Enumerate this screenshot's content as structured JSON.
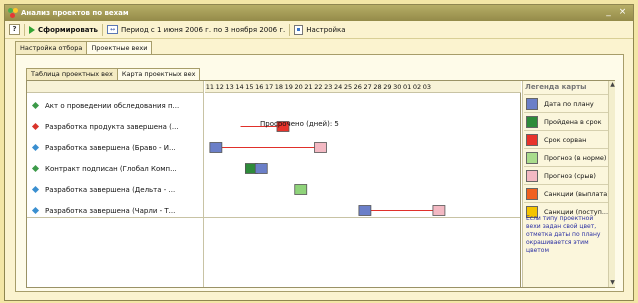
{
  "window": {
    "title": "Анализ проектов по вехам",
    "min_label": "_",
    "close_label": "×"
  },
  "toolbar": {
    "help_label": "?",
    "build_label": "Сформировать",
    "period_icon_label": "↔",
    "period_label": "Период с 1 июня 2006 г. по 3 ноября 2006 г.",
    "settings_label": "Настройка"
  },
  "tabs_top": [
    "Настройка отбора",
    "Проектные вехи"
  ],
  "tabs_inner": [
    "Таблица проектных вех",
    "Карта проектных вех"
  ],
  "rows": [
    {
      "label": "Акт о проведении обследования п...",
      "marker_color": "#3c9a49"
    },
    {
      "label": "Разработка продукта завершена (...",
      "marker_color": "#d9342b"
    },
    {
      "label": "Разработка завершена (Браво - И...",
      "marker_color": "#3a8fd0"
    },
    {
      "label": "Контракт подписан (Глобал Комп...",
      "marker_color": "#3c9a49"
    },
    {
      "label": "Разработка завершена (Дельта - ...",
      "marker_color": "#3a8fd0"
    },
    {
      "label": "Разработка завершена (Чарли - Т...",
      "marker_color": "#3a8fd0"
    }
  ],
  "days": [
    "11",
    "12",
    "13",
    "14",
    "15",
    "16",
    "17",
    "18",
    "19",
    "20",
    "21",
    "22",
    "23",
    "24",
    "25",
    "26",
    "27",
    "28",
    "29",
    "30",
    "01",
    "02",
    "03"
  ],
  "overdue_text": "Просрочено (дней): 5",
  "bars": [
    {
      "row": 1,
      "start_day": 14.1,
      "end_day": 18.4,
      "markers": [
        {
          "day": 18.4,
          "color": "#e8332b"
        }
      ]
    },
    {
      "row": 2,
      "start_day": 11.6,
      "end_day": 22.2,
      "markers": [
        {
          "day": 11.6,
          "color": "#6b7fc8"
        },
        {
          "day": 22.2,
          "color": "#f3b9c3"
        }
      ]
    },
    {
      "row": 3,
      "start_day": 15.2,
      "end_day": 16.2,
      "markers": [
        {
          "day": 15.2,
          "color": "#2e8b3a"
        },
        {
          "day": 16.2,
          "color": "#6b7fc8"
        }
      ]
    },
    {
      "row": 4,
      "start_day": 20.2,
      "end_day": 20.2,
      "markers": [
        {
          "day": 20.2,
          "color": "#8fd37a"
        }
      ]
    },
    {
      "row": 5,
      "start_day": 26.7,
      "end_day": 34.2,
      "markers": [
        {
          "day": 26.7,
          "color": "#6b7fc8"
        },
        {
          "day": 34.2,
          "color": "#f3b9c3"
        }
      ]
    }
  ],
  "legend": {
    "title": "Легенда карты",
    "items": [
      {
        "label": "Дата по плану",
        "color": "#6b7fc8"
      },
      {
        "label": "Пройдена в срок",
        "color": "#2e8b3a"
      },
      {
        "label": "Срок сорван",
        "color": "#e8332b"
      },
      {
        "label": "Прогноз (в норме)",
        "color": "#a9dc8c"
      },
      {
        "label": "Прогноз (срыв)",
        "color": "#f3b9c3"
      },
      {
        "label": "Санкции (выплата)",
        "color": "#f06020"
      },
      {
        "label": "Санкции (поступ...",
        "color": "#f5c400"
      }
    ],
    "note": "Если типу проектной вехи задан свой цвет, отметка даты по плану окрашивается этим цветом"
  }
}
